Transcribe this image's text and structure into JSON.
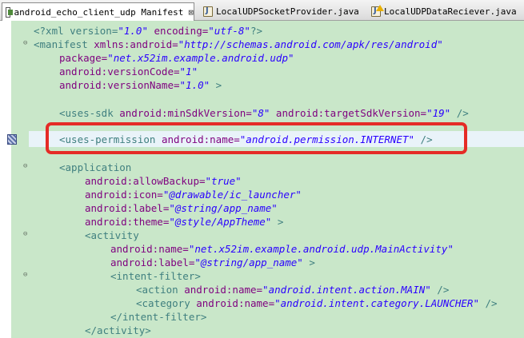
{
  "tabs": [
    {
      "label": "android_echo_client_udp Manifest",
      "close": "⊠",
      "active": true,
      "icon": "manifest-icon"
    },
    {
      "label": "LocalUDPSocketProvider.java",
      "active": false,
      "icon": "java-file-icon"
    },
    {
      "label": "LocalUDPDataReciever.java",
      "active": false,
      "icon": "java-file-warning-icon"
    }
  ],
  "highlight_color": "#e52b26",
  "code": {
    "l1": {
      "a": "<?xml version=",
      "b": "\"1.0\"",
      "c": " encoding=",
      "d": "\"utf-8\"",
      "e": "?>"
    },
    "l2": {
      "a": "<manifest",
      "b": " xmlns:android=",
      "c": "\"http://schemas.android.com/apk/res/android\""
    },
    "l3": {
      "a": "package=",
      "b": "\"net.x52im.example.android.udp\""
    },
    "l4": {
      "a": "android:versionCode=",
      "b": "\"1\""
    },
    "l5": {
      "a": "android:versionName=",
      "b": "\"1.0\"",
      "c": " >"
    },
    "l6": {
      "a": "<uses-sdk",
      "b": " android:minSdkVersion=",
      "c": "\"8\"",
      "d": " android:targetSdkVersion=",
      "e": "\"19\"",
      "f": " />"
    },
    "l7": {
      "a": "<uses-permission",
      "b": " android:name=",
      "c": "\"android.permission.INTERNET\"",
      "d": " />"
    },
    "l8": {
      "a": "<application"
    },
    "l9": {
      "a": "android:allowBackup=",
      "b": "\"true\""
    },
    "l10": {
      "a": "android:icon=",
      "b": "\"@drawable/ic_launcher\""
    },
    "l11": {
      "a": "android:label=",
      "b": "\"@string/app_name\""
    },
    "l12": {
      "a": "android:theme=",
      "b": "\"@style/AppTheme\"",
      "c": " >"
    },
    "l13": {
      "a": "<activity"
    },
    "l14": {
      "a": "android:name=",
      "b": "\"net.x52im.example.android.udp.MainActivity\""
    },
    "l15": {
      "a": "android:label=",
      "b": "\"@string/app_name\"",
      "c": " >"
    },
    "l16": {
      "a": "<intent-filter>"
    },
    "l17": {
      "a": "<action",
      "b": " android:name=",
      "c": "\"android.intent.action.MAIN\"",
      "d": " />"
    },
    "l18": {
      "a": "<category",
      "b": " android:name=",
      "c": "\"android.intent.category.LAUNCHER\"",
      "d": " />"
    },
    "l19": {
      "a": "</intent-filter>"
    },
    "l20": {
      "a": "</activity>"
    }
  },
  "fold_glyph": "⊖"
}
